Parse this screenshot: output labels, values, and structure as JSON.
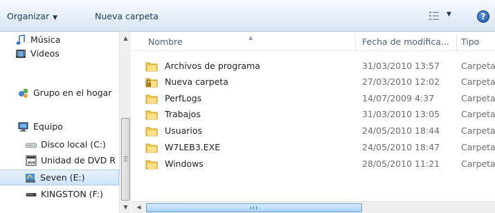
{
  "toolbar": {
    "organize_label": "Organizar",
    "new_folder_label": "Nueva carpeta",
    "view_icon": "view-options-icon",
    "help_icon": "help-icon",
    "help_glyph": "?"
  },
  "nav": {
    "items": [
      {
        "label": "Música",
        "icon": "music-library-icon"
      },
      {
        "label": "Vídeos",
        "icon": "videos-library-icon"
      },
      {
        "label": "Grupo en el hogar",
        "icon": "homegroup-icon"
      },
      {
        "label": "Equipo",
        "icon": "computer-icon"
      },
      {
        "label": "Disco local (C:)",
        "icon": "hard-drive-icon"
      },
      {
        "label": "Unidad de DVD R",
        "icon": "dvd-drive-icon"
      },
      {
        "label": "Seven (E:)",
        "icon": "usb-drive-icon",
        "selected": true
      },
      {
        "label": "KINGSTON (F:)",
        "icon": "removable-drive-icon"
      }
    ]
  },
  "content": {
    "columns": {
      "name": "Nombre",
      "date": "Fecha de modifica...",
      "type": "Tipo"
    },
    "files": [
      {
        "name": "Archivos de programa",
        "date": "31/03/2010 13:57",
        "type": "Carpeta"
      },
      {
        "name": "Nueva carpeta",
        "date": "27/03/2010 12:02",
        "type": "Carpeta",
        "locked": true
      },
      {
        "name": "PerfLogs",
        "date": "14/07/2009 4:37",
        "type": "Carpeta"
      },
      {
        "name": "Trabajos",
        "date": "31/03/2010 13:05",
        "type": "Carpeta"
      },
      {
        "name": "Usuarios",
        "date": "24/05/2010 18:44",
        "type": "Carpeta"
      },
      {
        "name": "W7LEB3.EXE",
        "date": "24/05/2010 18:47",
        "type": "Carpeta"
      },
      {
        "name": "Windows",
        "date": "28/05/2010 11:21",
        "type": "Carpeta"
      }
    ]
  },
  "colors": {
    "toolbar_top": "#f7fafd",
    "toolbar_bottom": "#dbe6f3",
    "folder_yellow": "#f2c94c",
    "selection_blue": "#cde4fb"
  }
}
